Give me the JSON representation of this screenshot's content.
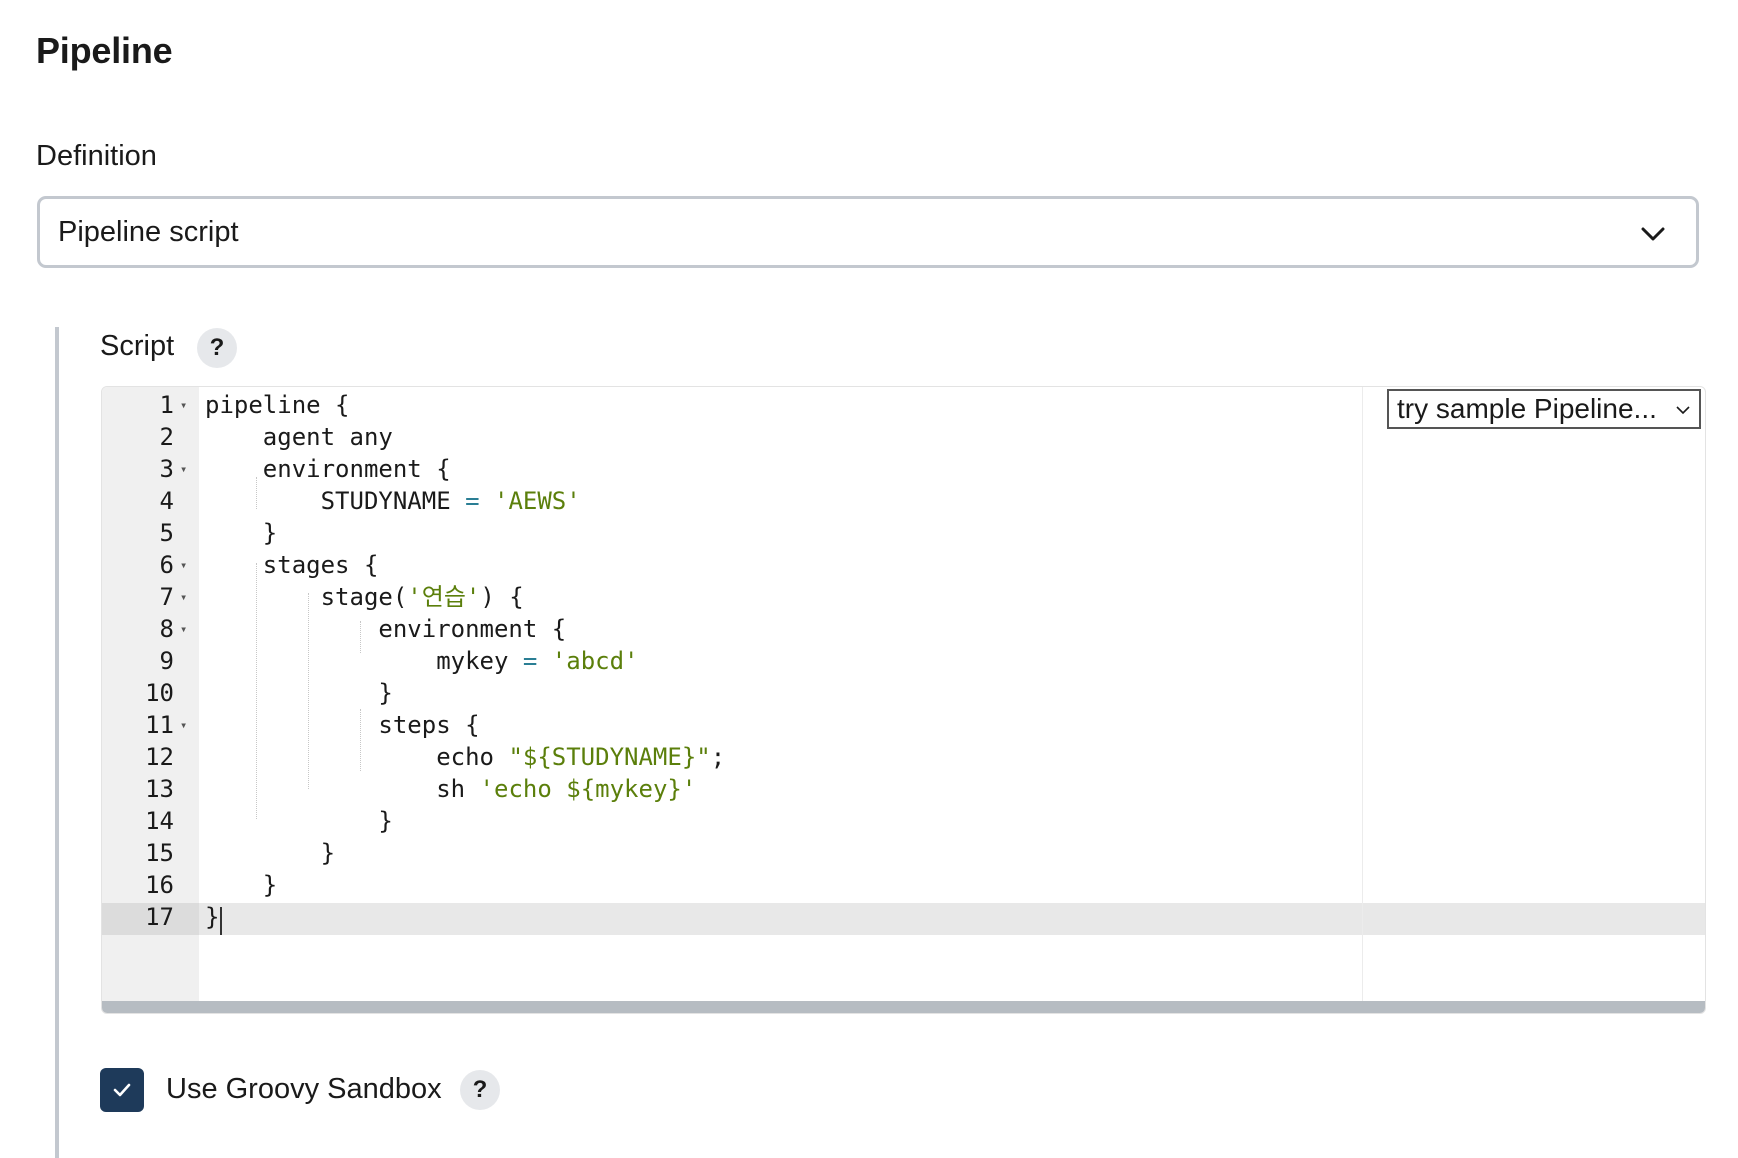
{
  "page": {
    "title": "Pipeline",
    "definition_label": "Definition",
    "definition_value": "Pipeline script",
    "definition_icon": "chevron-down-icon"
  },
  "script": {
    "label": "Script",
    "help": "?",
    "sample_select": "try sample Pipeline...",
    "sample_icon": "chevron-down-icon",
    "lines": [
      {
        "n": "1",
        "fold": true,
        "code": "pipeline {"
      },
      {
        "n": "2",
        "fold": false,
        "code": "    agent any"
      },
      {
        "n": "3",
        "fold": true,
        "code": "    environment {"
      },
      {
        "n": "4",
        "fold": false,
        "code": "        STUDYNAME = 'AEWS'"
      },
      {
        "n": "5",
        "fold": false,
        "code": "    }"
      },
      {
        "n": "6",
        "fold": true,
        "code": "    stages {"
      },
      {
        "n": "7",
        "fold": true,
        "code": "        stage('연습') {"
      },
      {
        "n": "8",
        "fold": true,
        "code": "            environment {"
      },
      {
        "n": "9",
        "fold": false,
        "code": "                mykey = 'abcd'"
      },
      {
        "n": "10",
        "fold": false,
        "code": "            }"
      },
      {
        "n": "11",
        "fold": true,
        "code": "            steps {"
      },
      {
        "n": "12",
        "fold": false,
        "code": "                echo \"${STUDYNAME}\";"
      },
      {
        "n": "13",
        "fold": false,
        "code": "                sh 'echo ${mykey}'"
      },
      {
        "n": "14",
        "fold": false,
        "code": "            }"
      },
      {
        "n": "15",
        "fold": false,
        "code": "        }"
      },
      {
        "n": "16",
        "fold": false,
        "code": "    }"
      },
      {
        "n": "17",
        "fold": false,
        "code": "}"
      }
    ],
    "string_color": "#5b7f0b",
    "operator_color": "#2a7e94"
  },
  "sandbox": {
    "label": "Use Groovy Sandbox",
    "checked": true,
    "help": "?",
    "checkbox_color": "#1e3a5a",
    "check_icon": "checkmark-icon"
  }
}
